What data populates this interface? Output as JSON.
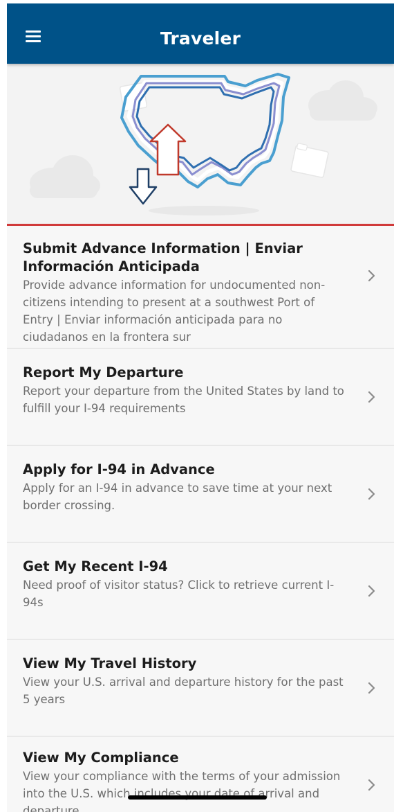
{
  "header": {
    "title": "Traveler"
  },
  "colors": {
    "header_bg": "#005288",
    "accent_rule": "#d03a3a",
    "title_text": "#1c1c1c",
    "description_text": "#6f6f6f"
  },
  "hero": {
    "illustration": "us-map-arrows-illustration"
  },
  "items": [
    {
      "title": "Submit Advance Information | Enviar Información Anticipada",
      "description": "Provide advance information for undocumented non-citizens intending to present at a southwest Port of Entry | Enviar información anticipada para no ciudadanos en la frontera sur",
      "icon": "chevron-right-icon"
    },
    {
      "title": "Report My Departure",
      "description": "Report your departure from the United States by land to fulfill your I-94 requirements",
      "icon": "chevron-right-icon"
    },
    {
      "title": "Apply for I-94 in Advance",
      "description": "Apply for an I-94 in advance to save time at your next border crossing.",
      "icon": "chevron-right-icon"
    },
    {
      "title": "Get My Recent I-94",
      "description": "Need proof of visitor status? Click to retrieve current I-94s",
      "icon": "chevron-right-icon"
    },
    {
      "title": "View My Travel History",
      "description": "View your U.S. arrival and departure history for the past 5 years",
      "icon": "chevron-right-icon"
    },
    {
      "title": "View My Compliance",
      "description": "View your compliance with the terms of your admission into the U.S. which includes your date of arrival and departure",
      "icon": "chevron-right-icon"
    }
  ]
}
